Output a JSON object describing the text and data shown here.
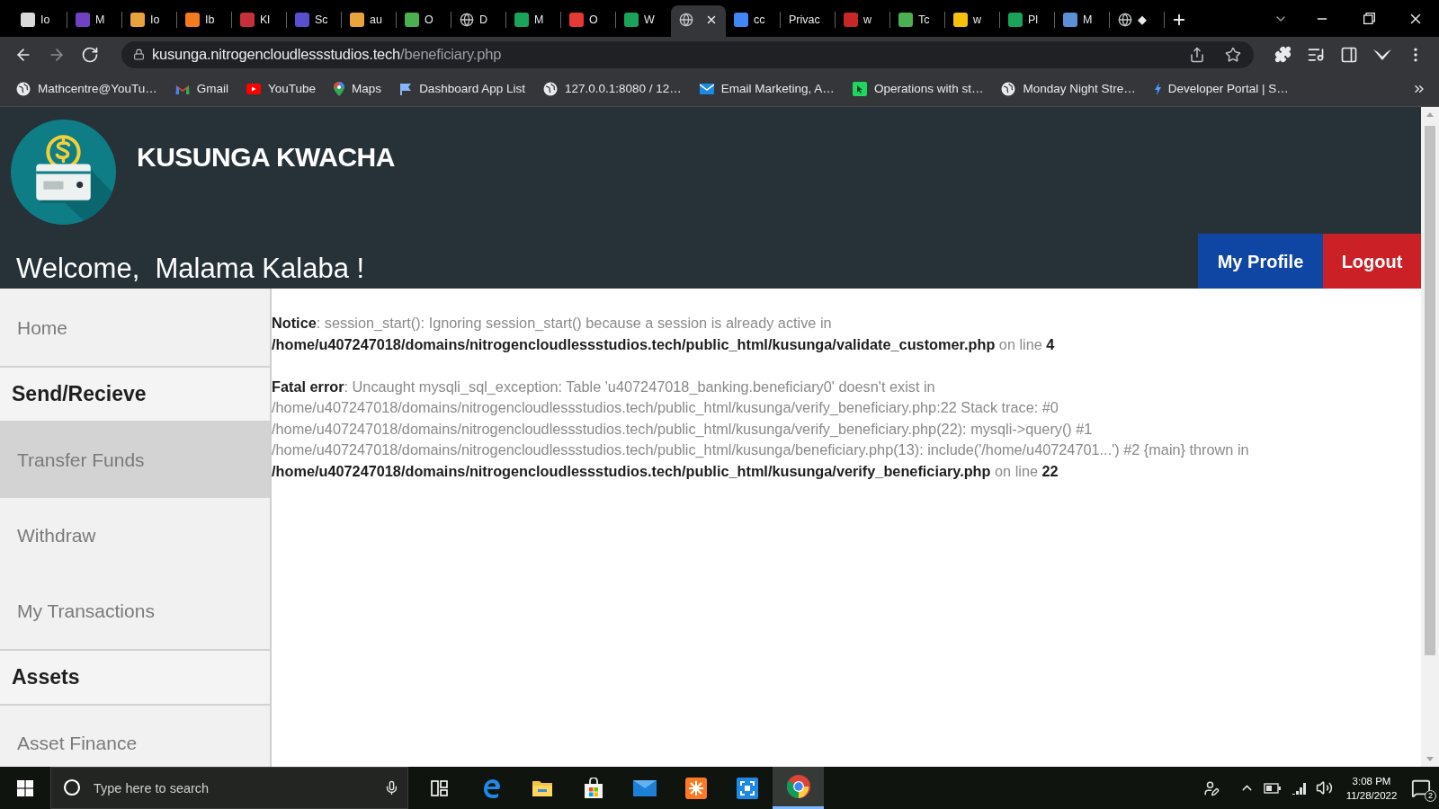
{
  "browser": {
    "tabs": [
      {
        "kind": "tile",
        "color": "#d9d9d9",
        "title": "Io",
        "selected": false
      },
      {
        "kind": "tile",
        "color": "#6f42c1",
        "title": "M",
        "selected": false
      },
      {
        "kind": "tile",
        "color": "#e8a33c",
        "title": "Io",
        "selected": false
      },
      {
        "kind": "tile",
        "color": "#f47a20",
        "title": "Ib",
        "selected": false
      },
      {
        "kind": "tile",
        "color": "#c62f3c",
        "title": "Kl",
        "selected": false
      },
      {
        "kind": "tile",
        "color": "#5a4fcf",
        "title": "Sc",
        "selected": false
      },
      {
        "kind": "tile",
        "color": "#e8a33c",
        "title": "au",
        "selected": false
      },
      {
        "kind": "tile",
        "color": "#4caf50",
        "title": "O",
        "selected": false
      },
      {
        "kind": "globe",
        "title": "D",
        "selected": false
      },
      {
        "kind": "tile",
        "color": "#1aa35a",
        "title": "M",
        "selected": false
      },
      {
        "kind": "tile",
        "color": "#e53935",
        "title": "O",
        "selected": false
      },
      {
        "kind": "tile",
        "color": "#1aa35a",
        "title": "W",
        "selected": false
      },
      {
        "kind": "globe",
        "selected": true
      },
      {
        "kind": "tile",
        "color": "#4285f4",
        "title": "cc",
        "selected": false
      },
      {
        "kind": "none",
        "title": "Privac",
        "selected": false
      },
      {
        "kind": "tile",
        "color": "#c62828",
        "title": "w",
        "selected": false
      },
      {
        "kind": "tile",
        "color": "#4caf50",
        "title": "Tc",
        "selected": false
      },
      {
        "kind": "tile",
        "color": "#f4c20d",
        "title": "w",
        "selected": false
      },
      {
        "kind": "tile",
        "color": "#1aa35a",
        "title": "Pl",
        "selected": false
      },
      {
        "kind": "tile",
        "color": "#5c8fd6",
        "title": "M",
        "selected": false
      },
      {
        "kind": "globe",
        "title": "◆",
        "selected": false
      }
    ],
    "address": {
      "host": "kusunga.nitrogencloudlessstudios.tech",
      "path": "/beneficiary.php"
    },
    "bookmarks": [
      {
        "kind": "globe",
        "label": "Mathcentre@YouTu…"
      },
      {
        "kind": "gmail",
        "label": "Gmail"
      },
      {
        "kind": "youtube",
        "label": "YouTube"
      },
      {
        "kind": "maps",
        "label": "Maps"
      },
      {
        "kind": "flag",
        "label": "Dashboard App List"
      },
      {
        "kind": "globe",
        "label": "127.0.0.1:8080 / 12…"
      },
      {
        "kind": "envelope",
        "label": "Email Marketing, A…"
      },
      {
        "kind": "square",
        "label": "Operations with st…"
      },
      {
        "kind": "globe",
        "label": "Monday Night Stre…"
      },
      {
        "kind": "drop",
        "label": "Developer Portal | S…"
      }
    ]
  },
  "page": {
    "brand": "KUSUNGA KWACHA",
    "welcome": "Welcome,  Malama Kalaba !",
    "actions": [
      {
        "kind": "profile",
        "label": "My Profile"
      },
      {
        "kind": "logout",
        "label": "Logout"
      }
    ],
    "sidebar": [
      {
        "kind": "link",
        "label": "Home",
        "selected": false
      },
      {
        "kind": "heading",
        "label": "Send/Recieve"
      },
      {
        "kind": "link",
        "label": "Transfer Funds",
        "selected": true
      },
      {
        "kind": "link",
        "label": "Withdraw",
        "selected": false
      },
      {
        "kind": "link",
        "label": "My Transactions",
        "selected": false
      },
      {
        "kind": "heading",
        "label": "Assets"
      },
      {
        "kind": "link",
        "label": "Asset Finance",
        "selected": false
      }
    ],
    "messages": [
      {
        "lines": [
          "**Notice**: session_start(): Ignoring session_start() because a session is already active in",
          "**/home/u407247018/domains/nitrogencloudlessstudios.tech/public_html/kusunga/validate_customer.php** on line **4**"
        ]
      },
      {
        "lines": [
          "**Fatal error**: Uncaught mysqli_sql_exception: Table 'u407247018_banking.beneficiary0' doesn't exist in",
          "/home/u407247018/domains/nitrogencloudlessstudios.tech/public_html/kusunga/verify_beneficiary.php:22 Stack trace: #0",
          "/home/u407247018/domains/nitrogencloudlessstudios.tech/public_html/kusunga/verify_beneficiary.php(22): mysqli->query() #1",
          "/home/u407247018/domains/nitrogencloudlessstudios.tech/public_html/kusunga/beneficiary.php(13): include('/home/u40724701...') #2 {main} thrown in",
          "**/home/u407247018/domains/nitrogencloudlessstudios.tech/public_html/kusunga/verify_beneficiary.php** on line **22**"
        ]
      }
    ]
  },
  "taskbar": {
    "search": {
      "placeholder": "Type here to search"
    },
    "apps": [
      {
        "kind": "task-view",
        "selected": false
      },
      {
        "kind": "edge",
        "selected": false
      },
      {
        "kind": "explorer",
        "selected": false
      },
      {
        "kind": "store",
        "selected": false
      },
      {
        "kind": "mail",
        "selected": false
      },
      {
        "kind": "xampp",
        "selected": false
      },
      {
        "kind": "frame",
        "selected": false
      },
      {
        "kind": "chrome",
        "selected": true
      }
    ],
    "clock": {
      "time": "3:08 PM",
      "date": "11/28/2022"
    },
    "notifications": "2"
  }
}
